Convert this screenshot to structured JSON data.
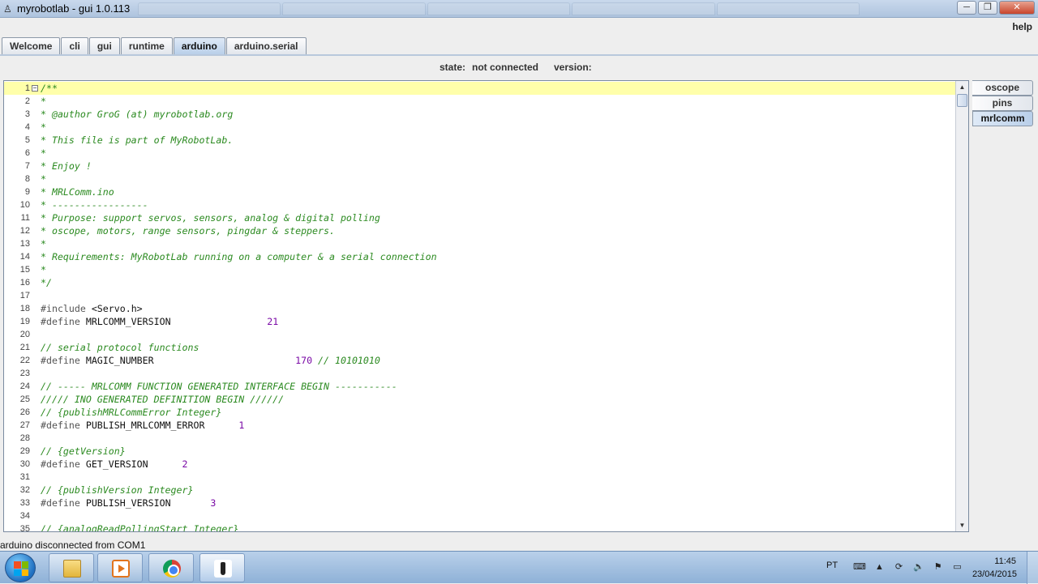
{
  "window": {
    "title": "myrobotlab - gui 1.0.113",
    "minimize": "─",
    "maximize": "❐",
    "close": "✕"
  },
  "menu": {
    "help": "help"
  },
  "tabs": [
    {
      "label": "Welcome"
    },
    {
      "label": "cli"
    },
    {
      "label": "gui"
    },
    {
      "label": "runtime"
    },
    {
      "label": "arduino",
      "active": true
    },
    {
      "label": "arduino.serial"
    }
  ],
  "state": {
    "label": "state:",
    "value": "not connected",
    "version_label": "version:"
  },
  "code_lines": [
    [
      [
        "/**",
        "com"
      ]
    ],
    [
      [
        "*",
        "com"
      ]
    ],
    [
      [
        "* @author GroG (at) myrobotlab.org",
        "com"
      ]
    ],
    [
      [
        "*",
        "com"
      ]
    ],
    [
      [
        "* This file is part of MyRobotLab.",
        "com"
      ]
    ],
    [
      [
        "*",
        "com"
      ]
    ],
    [
      [
        "* Enjoy !",
        "com"
      ]
    ],
    [
      [
        "*",
        "com"
      ]
    ],
    [
      [
        "* MRLComm.ino",
        "com"
      ]
    ],
    [
      [
        "* -----------------",
        "com"
      ]
    ],
    [
      [
        "* Purpose: support servos, sensors, analog & digital polling",
        "com"
      ]
    ],
    [
      [
        "* oscope, motors, range sensors, pingdar & steppers.",
        "com"
      ]
    ],
    [
      [
        "*",
        "com"
      ]
    ],
    [
      [
        "* Requirements: MyRobotLab running on a computer & a serial connection",
        "com"
      ]
    ],
    [
      [
        "*",
        "com"
      ]
    ],
    [
      [
        "*/",
        "com"
      ]
    ],
    [],
    [
      [
        "#include ",
        "pp"
      ],
      [
        "<Servo.h>",
        "plain"
      ]
    ],
    [
      [
        "#define ",
        "pp"
      ],
      [
        "MRLCOMM_VERSION",
        "plain"
      ],
      [
        "                 ",
        "plain"
      ],
      [
        "21",
        "num"
      ]
    ],
    [],
    [
      [
        "// serial protocol functions",
        "com"
      ]
    ],
    [
      [
        "#define ",
        "pp"
      ],
      [
        "MAGIC_NUMBER",
        "plain"
      ],
      [
        "                         ",
        "plain"
      ],
      [
        "170",
        "num"
      ],
      [
        " // 10101010",
        "com"
      ]
    ],
    [],
    [
      [
        "// ----- MRLCOMM FUNCTION GENERATED INTERFACE BEGIN -----------",
        "com"
      ]
    ],
    [
      [
        "///// INO GENERATED DEFINITION BEGIN //////",
        "com"
      ]
    ],
    [
      [
        "// {publishMRLCommError Integer}",
        "com"
      ]
    ],
    [
      [
        "#define ",
        "pp"
      ],
      [
        "PUBLISH_MRLCOMM_ERROR",
        "plain"
      ],
      [
        "      ",
        "plain"
      ],
      [
        "1",
        "num"
      ]
    ],
    [],
    [
      [
        "// {getVersion}",
        "com"
      ]
    ],
    [
      [
        "#define ",
        "pp"
      ],
      [
        "GET_VERSION",
        "plain"
      ],
      [
        "      ",
        "plain"
      ],
      [
        "2",
        "num"
      ]
    ],
    [],
    [
      [
        "// {publishVersion Integer}",
        "com"
      ]
    ],
    [
      [
        "#define ",
        "pp"
      ],
      [
        "PUBLISH_VERSION",
        "plain"
      ],
      [
        "       ",
        "plain"
      ],
      [
        "3",
        "num"
      ]
    ],
    [],
    [
      [
        "// {analogReadPollingStart Integer}",
        "com"
      ]
    ]
  ],
  "side_tabs": [
    {
      "label": "oscope"
    },
    {
      "label": "pins"
    },
    {
      "label": "mrlcomm",
      "active": true
    }
  ],
  "status": "arduino disconnected from COM1",
  "taskbar": {
    "language": "PT",
    "time": "11:45",
    "date": "23/04/2015",
    "apps": [
      "file-explorer-icon",
      "media-player-icon",
      "chrome-icon",
      "myrobotlab-icon"
    ]
  }
}
